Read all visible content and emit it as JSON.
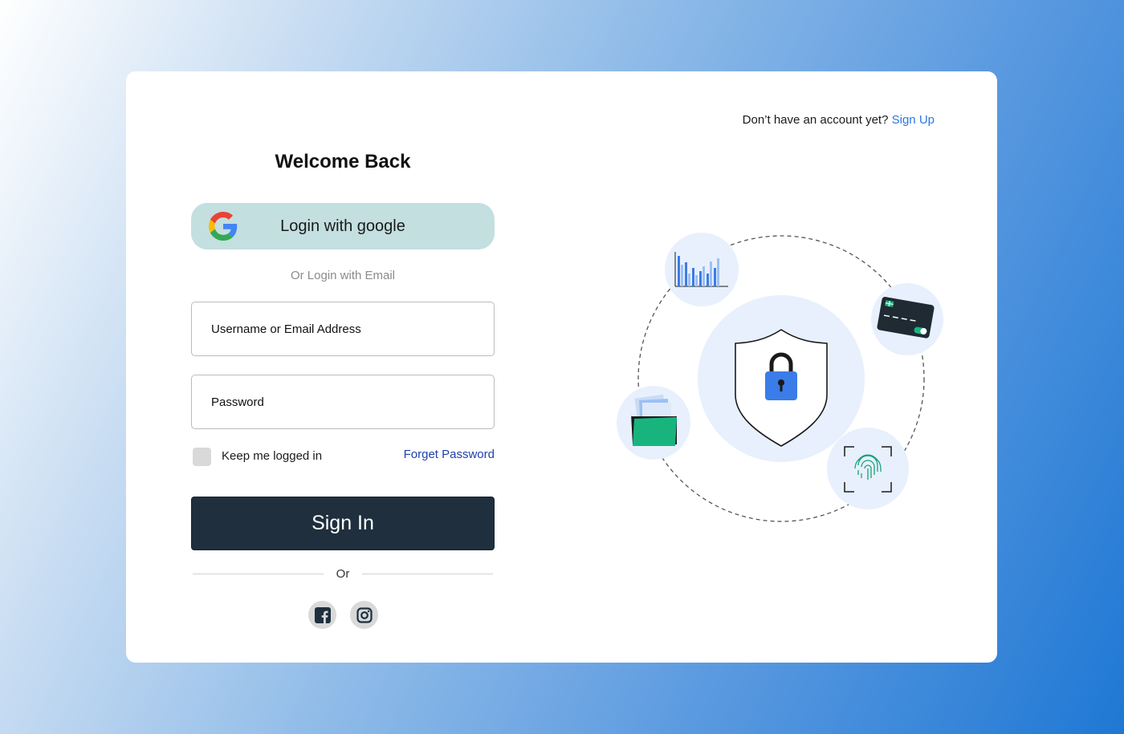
{
  "header": {
    "signup_prompt": "Don’t have an account yet?",
    "signup_link": "Sign Up"
  },
  "login": {
    "title": "Welcome Back",
    "google_label": "Login with google",
    "or_email": "Or Login with Email",
    "username_placeholder": "Username or Email Address",
    "password_placeholder": "Password",
    "keep_logged_in": "Keep me logged in",
    "forget_password": "Forget Password",
    "sign_in": "Sign In",
    "or_divider": "Or"
  },
  "social": {
    "icons": [
      "facebook-icon",
      "instagram-icon"
    ]
  },
  "illustration": {
    "icons": [
      "bar-chart-icon",
      "credit-card-icon",
      "shield-lock-icon",
      "folder-icon",
      "fingerprint-icon"
    ]
  },
  "colors": {
    "link": "#2a79e0",
    "forget_link": "#1f3fa8",
    "google_button_bg": "#c4dfe0",
    "sign_in_bg": "#1f2f3d",
    "lock_blue": "#3b7ce8",
    "folder_green": "#17b57d",
    "fingerprint_green": "#18a37a"
  }
}
